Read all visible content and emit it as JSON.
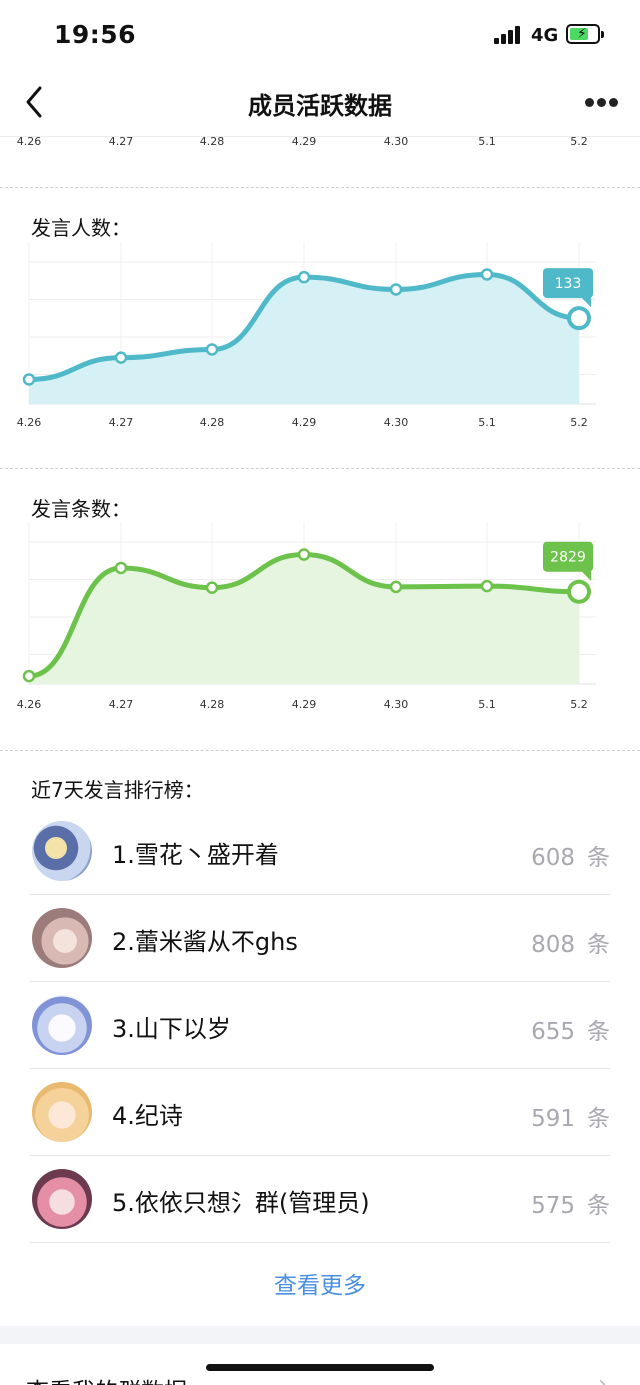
{
  "status_bar": {
    "time": "19:56",
    "network": "4G"
  },
  "nav": {
    "title": "成员活跃数据"
  },
  "x_ticks": [
    "4.26",
    "4.27",
    "4.28",
    "4.29",
    "4.30",
    "5.1",
    "5.2"
  ],
  "speakers_section": {
    "title": "发言人数："
  },
  "messages_section": {
    "title": "发言条数："
  },
  "chart_data": [
    {
      "type": "area",
      "x": [
        "4.26",
        "4.27",
        "4.28",
        "4.29",
        "4.30",
        "5.1",
        "5.2"
      ],
      "values": [
        88,
        104,
        110,
        163,
        154,
        165,
        133
      ],
      "ylim": [
        70,
        180
      ],
      "highlight_label": "133",
      "color": "#4fb9c9",
      "fill": "#d5f1f5",
      "grid": true
    },
    {
      "type": "area",
      "x": [
        "4.26",
        "4.27",
        "4.28",
        "4.29",
        "4.30",
        "5.1",
        "5.2"
      ],
      "values": [
        1760,
        3130,
        2880,
        3300,
        2890,
        2900,
        2829
      ],
      "ylim": [
        1660,
        3560
      ],
      "highlight_label": "2829",
      "color": "#6cc24a",
      "fill": "#e6f5df",
      "grid": true
    }
  ],
  "ranking": {
    "title": "近7天发言排行榜：",
    "unit": "条",
    "items": [
      {
        "name": "1.雪花丶盛开着",
        "count": "608"
      },
      {
        "name": "2.蕾米酱从不ghs",
        "count": "808"
      },
      {
        "name": "3.山下以岁",
        "count": "655"
      },
      {
        "name": "4.纪诗",
        "count": "591"
      },
      {
        "name": "5.依依只想氵群(管理员)",
        "count": "575"
      }
    ]
  },
  "view_more": "查看更多",
  "my_group_data": "查看我的群数据",
  "colors": {
    "accent_blue": "#4a90e2",
    "teal": "#4fb9c9",
    "green": "#6cc24a"
  }
}
